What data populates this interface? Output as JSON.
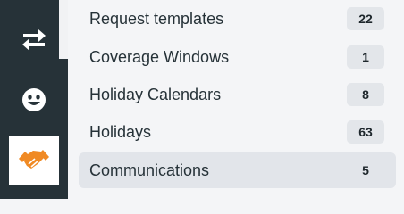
{
  "rail": {
    "items": [
      {
        "icon": "swap-arrows-icon"
      },
      {
        "icon": "smiley-face-icon"
      },
      {
        "icon": "handshake-icon",
        "active": true
      }
    ],
    "colors": {
      "background": "#263238",
      "icon": "#ffffff",
      "accent": "#f08a24"
    }
  },
  "list": {
    "items": [
      {
        "label": "Request templates",
        "count": "22"
      },
      {
        "label": "Coverage Windows",
        "count": "1"
      },
      {
        "label": "Holiday Calendars",
        "count": "8"
      },
      {
        "label": "Holidays",
        "count": "63"
      },
      {
        "label": "Communications",
        "count": "5",
        "selected": true
      }
    ]
  }
}
